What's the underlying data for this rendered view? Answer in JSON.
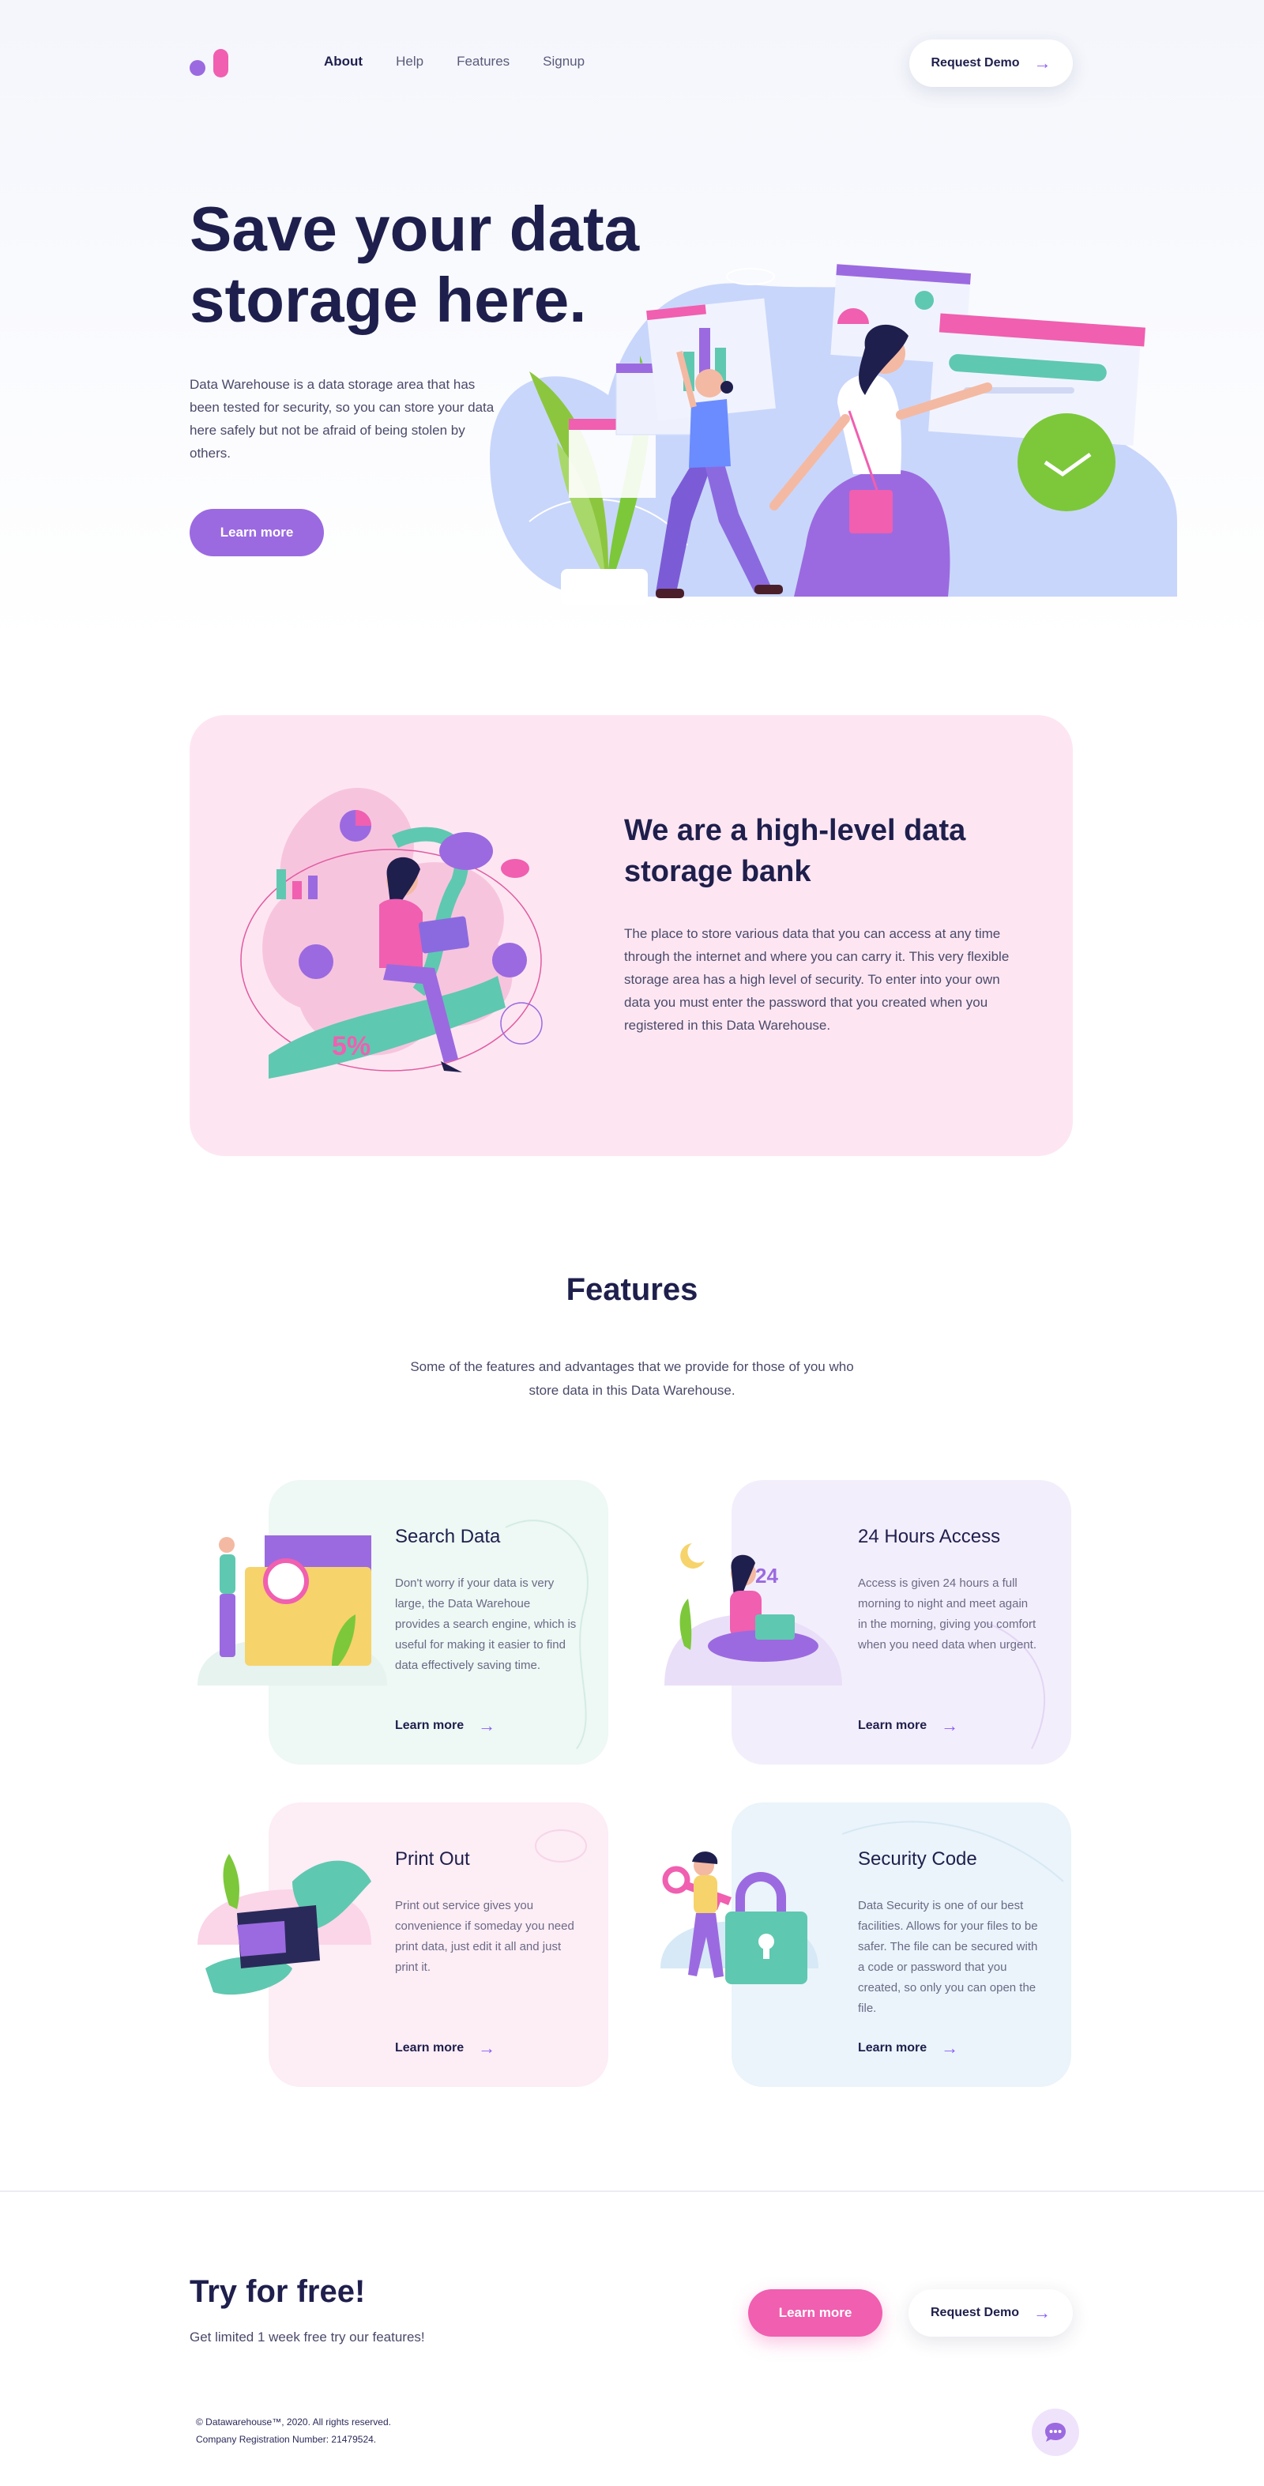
{
  "nav": {
    "links": [
      "About",
      "Help",
      "Features",
      "Signup"
    ],
    "request_demo": "Request Demo",
    "arrow": "→"
  },
  "hero": {
    "title_line1": "Save your data",
    "title_line2": "storage here.",
    "description": "Data Warehouse is a data storage area that has been  tested for security, so you can store your data here  safely but not be afraid of being stolen by others.",
    "cta": "Learn more"
  },
  "about": {
    "title": "We are a high-level data storage bank",
    "description": "The place to store various data that you can access at any time through the internet  and where you can carry it. This very flexible storage area has a high level of security. To enter into your own data you must enter the password that you created when you registered in this Data Warehouse.",
    "badge": "5%"
  },
  "features": {
    "title": "Features",
    "subtitle": "Some of the features and advantages that we provide for those of you who store data in this Data Warehouse.",
    "cards": [
      {
        "title": "Search Data",
        "description": "Don't worry if your data is very large, the Data Warehoue provides a search engine, which is useful for making it easier to find data effectively saving time.",
        "link": "Learn more",
        "color": "#eef8f4"
      },
      {
        "title": "24 Hours Access",
        "description": "Access is given 24 hours a full morning to night and  meet again in the morning, giving you comfort when  you need data when urgent.",
        "link": "Learn more",
        "badge": "24",
        "color": "#f3eefb"
      },
      {
        "title": "Print Out",
        "description": "Print out service gives you convenience if someday  you need print data, just edit it all and just print it.",
        "link": "Learn more",
        "color": "#fdedf5"
      },
      {
        "title": "Security Code",
        "description": "Data Security is one of our best facilities. Allows for your files  to be safer. The file can be secured with a code or password that   you created, so only you can open the file.",
        "link": "Learn more",
        "color": "#eaf4fa"
      }
    ]
  },
  "cta": {
    "title": "Try for free!",
    "subtitle": "Get limited 1 week free try our features!",
    "learn_more": "Learn more",
    "request_demo": "Request Demo"
  },
  "footer": {
    "copyright": "© Datawarehouse™, 2020. All rights reserved.",
    "registration": "Company Registration Number: 21479524."
  },
  "colors": {
    "navy": "#1f1f4d",
    "purple": "#9b6ae0",
    "pink": "#f05fb0",
    "teal": "#5fc8b0",
    "green": "#7cc83a"
  },
  "icons": [
    "logo-icon",
    "arrow-right-icon",
    "chat-icon"
  ]
}
